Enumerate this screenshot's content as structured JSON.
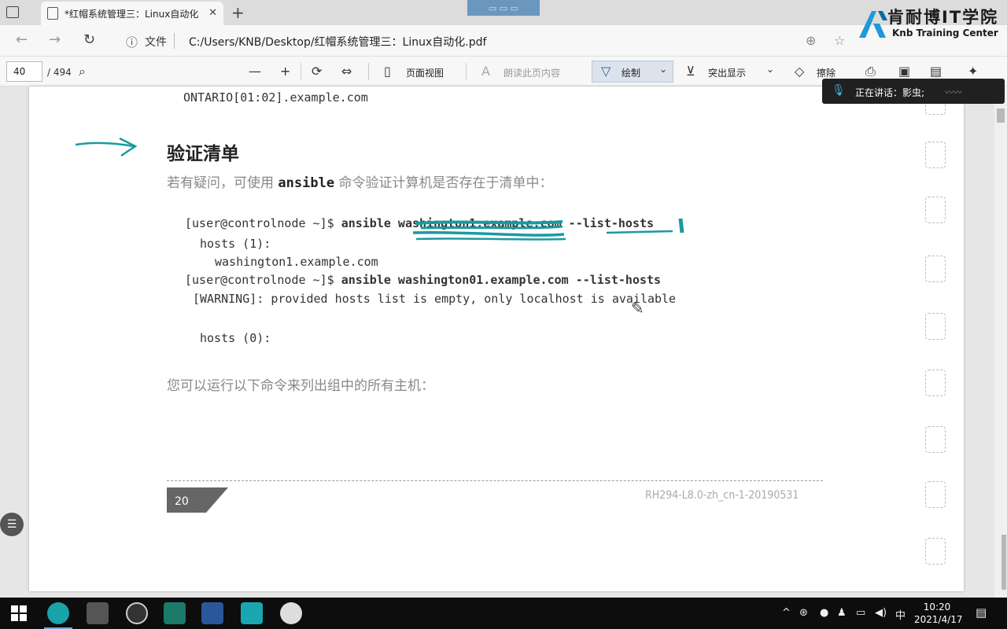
{
  "browser": {
    "tab_title": "*红帽系统管理三：Linux自动化.p",
    "tab_close": "✕",
    "new_tab": "+",
    "address_label": "文件",
    "address_url": "C:/Users/KNB/Desktop/红帽系统管理三：Linux自动化.pdf"
  },
  "logo": {
    "cn": "肯耐博IT学院",
    "en": "Knb Training Center"
  },
  "pdf_toolbar": {
    "page_current": "40",
    "page_total": "/ 494",
    "page_view": "页面视图",
    "read_aloud": "朗读此页内容",
    "draw": "绘制",
    "highlight": "突出显示",
    "erase": "擦除"
  },
  "speaker_popup": {
    "text": "正在讲话：影虫;"
  },
  "document": {
    "top_line": "ONTARIO[01:02].example.com",
    "heading": "验证清单",
    "intro_before": "若有疑问，可使用 ",
    "intro_cmd": "ansible",
    "intro_after": " 命令验证计算机是否存在于清单中：",
    "code1_prompt": "[user@controlnode ~]$ ",
    "code1_cmd": "ansible washington1.example.com --list-hosts",
    "code1_hosts": "hosts (1):",
    "code1_host": "washington1.example.com",
    "code2_prompt": "[user@controlnode ~]$ ",
    "code2_cmd": "ansible washington01.example.com --list-hosts",
    "code2_warning": "[WARNING]: provided hosts list is empty, only localhost is available",
    "code2_hosts": "hosts (0):",
    "list_text": "您可以运行以下命令来列出组中的所有主机：",
    "footer_page": "20",
    "footer_code": "RH294-L8.0-zh_cn-1-20190531"
  },
  "taskbar": {
    "time": "10:20",
    "date": "2021/4/17",
    "ime": "中"
  },
  "colors": {
    "annotation": "#1a9aa0",
    "taskbar": "#0d0d0d"
  }
}
